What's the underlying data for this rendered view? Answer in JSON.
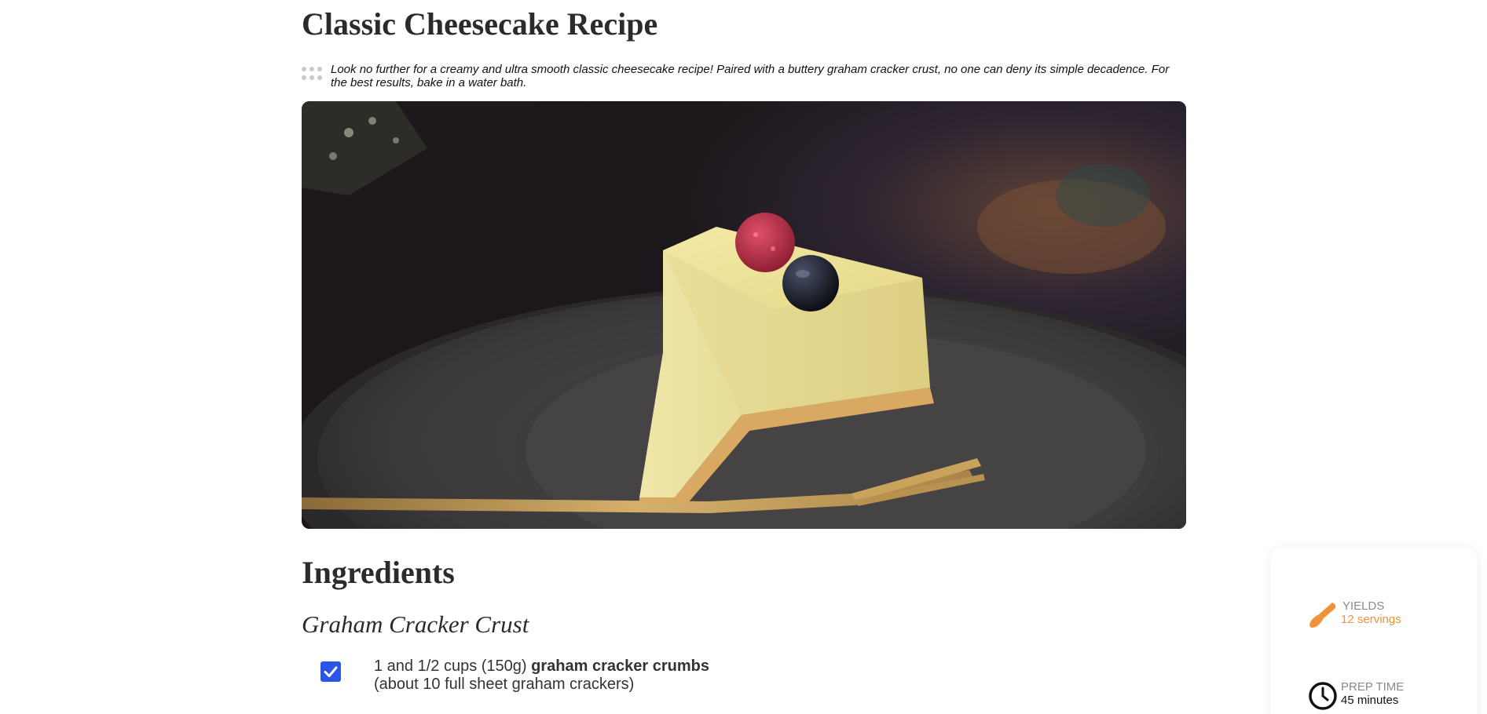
{
  "recipe": {
    "title": "Classic Cheesecake Recipe",
    "description": "Look no further for a creamy and ultra smooth classic cheesecake recipe! Paired with a buttery graham cracker crust, no one can deny its simple decadence. For the best results, bake in a water bath."
  },
  "ingredients": {
    "heading": "Ingredients",
    "sections": [
      {
        "title": "Graham Cracker Crust",
        "items": [
          {
            "checked": true,
            "amount": "1 and 1/2 cups (150g)",
            "name": "graham cracker crumbs",
            "note": "(about 10 full sheet graham crackers)"
          }
        ]
      }
    ]
  },
  "info_card": {
    "yields": {
      "label": "YIELDS",
      "value": "12 servings",
      "icon": "whisk-icon"
    },
    "prep_time": {
      "label": "PREP TIME",
      "value": "45 minutes",
      "icon": "clock-icon"
    }
  },
  "colors": {
    "accent_orange": "#f0923a",
    "checkbox_blue": "#2a55e6",
    "heading_text": "#2b2b2b"
  }
}
